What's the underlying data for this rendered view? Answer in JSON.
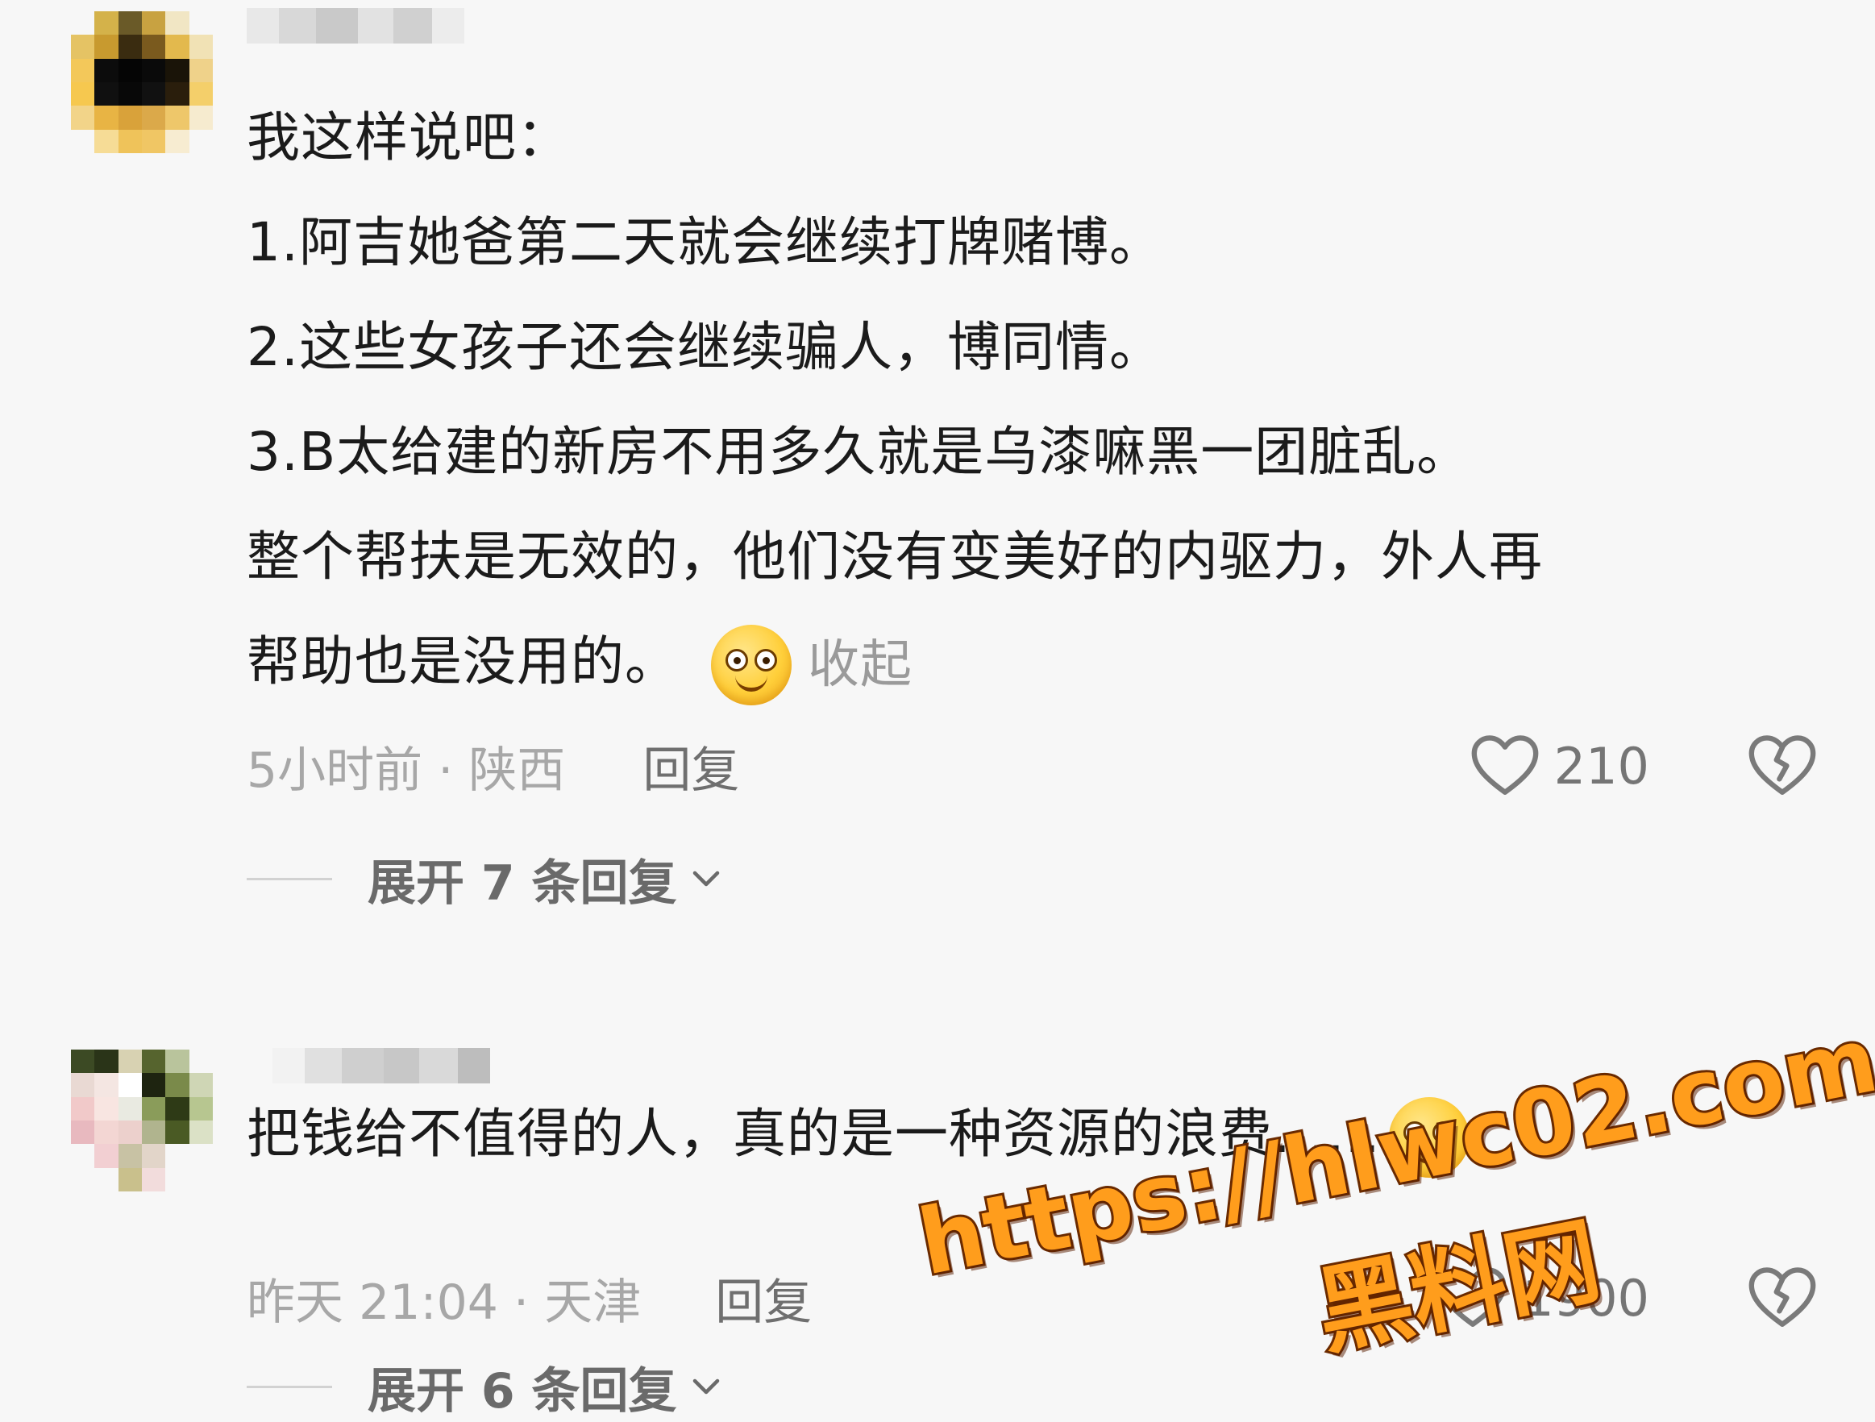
{
  "comments": [
    {
      "avatar_colors": [
        "#f7f7f7",
        "#d4b24a",
        "#6a5a28",
        "#c8a241",
        "#f1e6c4",
        "#f7f7f7",
        "#e5c364",
        "#c89a2f",
        "#3a2c10",
        "#7a5a1e",
        "#e3b94d",
        "#f1e2b5",
        "#f3c85a",
        "#0c0c0c",
        "#050505",
        "#0a0a0a",
        "#1a1408",
        "#efd28a",
        "#f6c84f",
        "#101010",
        "#080808",
        "#111111",
        "#2a1e0c",
        "#f4cf6a",
        "#f2d489",
        "#e8b444",
        "#d9a23a",
        "#dba94a",
        "#eec76a",
        "#f6ebcf",
        "#f7f7f7",
        "#f6dc96",
        "#efc35a",
        "#f0c664",
        "#f7ecd1",
        "#f7f7f7"
      ],
      "username_blocks": [
        "#e8e8e8",
        "#d8d8d8",
        "#c9c9c9",
        "#e2e2e2",
        "#d0d0d0",
        "#ececec"
      ],
      "lines": [
        "我这样说吧：",
        "1.阿吉她爸第二天就会继续打牌赌博。",
        "2.这些女孩子还会继续骗人，博同情。",
        "3.B太给建的新房不用多久就是乌漆嘛黑一团脏乱。",
        "整个帮扶是无效的，他们没有变美好的内驱力，外人再",
        "帮助也是没用的。"
      ],
      "collapse_label": "收起",
      "time_location": "5小时前 · 陕西",
      "reply_label": "回复",
      "like_count": "210",
      "expand_label": "展开 7 条回复"
    },
    {
      "avatar_colors": [
        "#3c4a24",
        "#2a3418",
        "#d8d2b2",
        "#56642e",
        "#b9c49c",
        "#f7f7f7",
        "#e9d9d3",
        "#f4e6e2",
        "#ffffff",
        "#1e2410",
        "#7a8a4a",
        "#cfd6b5",
        "#f1c9c9",
        "#f8e5e1",
        "#e9eae1",
        "#8a9c5a",
        "#2e3a16",
        "#b7c690",
        "#e8b9bf",
        "#f3d6d3",
        "#ecd0cc",
        "#b0b48e",
        "#4a5a24",
        "#dbe1c6",
        "#f7f7f7",
        "#f2cfd2",
        "#c8c2a4",
        "#e2d5c9",
        "#f7f7f7",
        "#f7f7f7",
        "#f7f7f7",
        "#f7f7f7",
        "#c9c08c",
        "#f2dcdc",
        "#f7f7f7",
        "#f7f7f7"
      ],
      "username_blocks": [
        "#f2f2f2",
        "#e0e0e0",
        "#cfcfcf",
        "#c7c7c7",
        "#d9d9d9",
        "#bdbdbd"
      ],
      "lines": [
        "把钱给不值得的人，真的是一种资源的浪费……"
      ],
      "time_location": "昨天 21:04 · 天津",
      "reply_label": "回复",
      "like_count": "1900",
      "expand_label": "展开 6 条回复"
    }
  ],
  "watermark": {
    "url": "https://hlwc02.com",
    "brand": "黑料网",
    "color": "#ff9d1c"
  },
  "icons": {
    "like": "heart-outline-icon",
    "dislike": "broken-heart-icon",
    "expand": "chevron-down-icon",
    "emoji": "smiley-emoji-icon"
  }
}
